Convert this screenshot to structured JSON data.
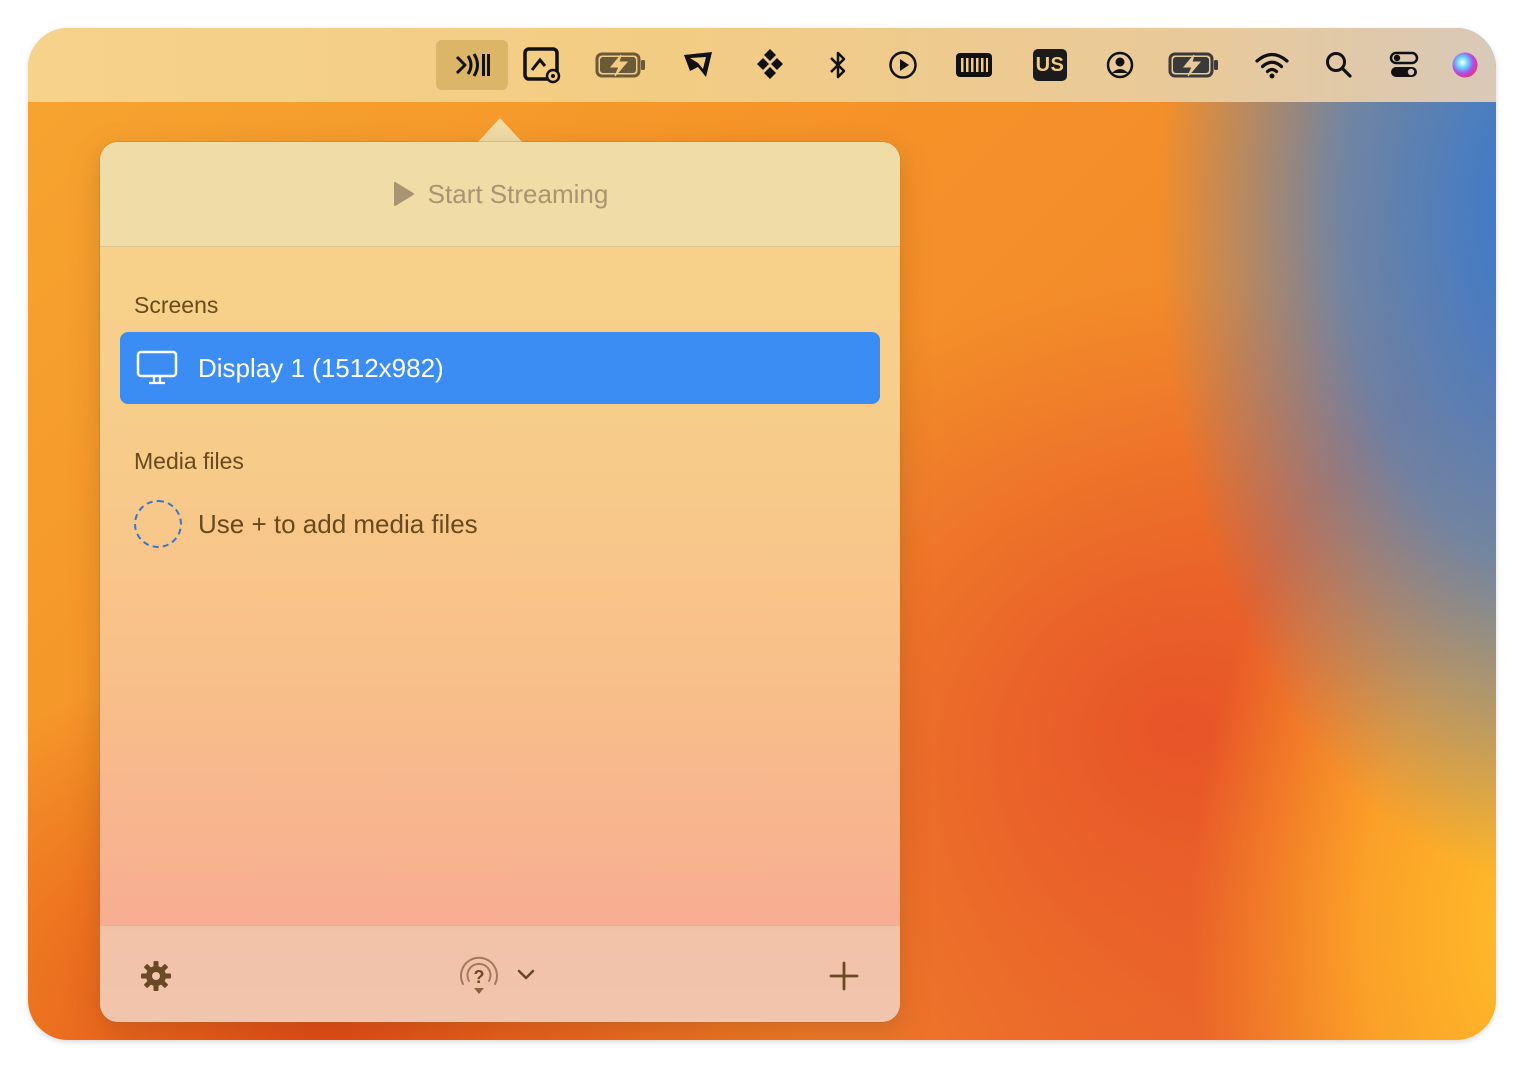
{
  "menubar": {
    "icons": [
      "airplay-stream-icon",
      "screen-capture-icon",
      "battery-charging-icon",
      "cursor-arrow-icon",
      "dots-grid-icon",
      "bluetooth-icon",
      "play-circle-icon",
      "memory-icon",
      "keyboard-layout-icon",
      "user-account-icon",
      "battery-charging-icon",
      "wifi-icon",
      "search-icon",
      "control-center-icon",
      "siri-icon"
    ],
    "keyboard_layout": "US"
  },
  "popover": {
    "start_button": "Start Streaming",
    "screens_label": "Screens",
    "screens": [
      {
        "label": "Display 1 (1512x982)",
        "selected": true
      }
    ],
    "media_label": "Media files",
    "media_empty_text": "Use + to add media files"
  },
  "colors": {
    "selection": "#3b8cf3",
    "menubar": "#f3cc84"
  }
}
